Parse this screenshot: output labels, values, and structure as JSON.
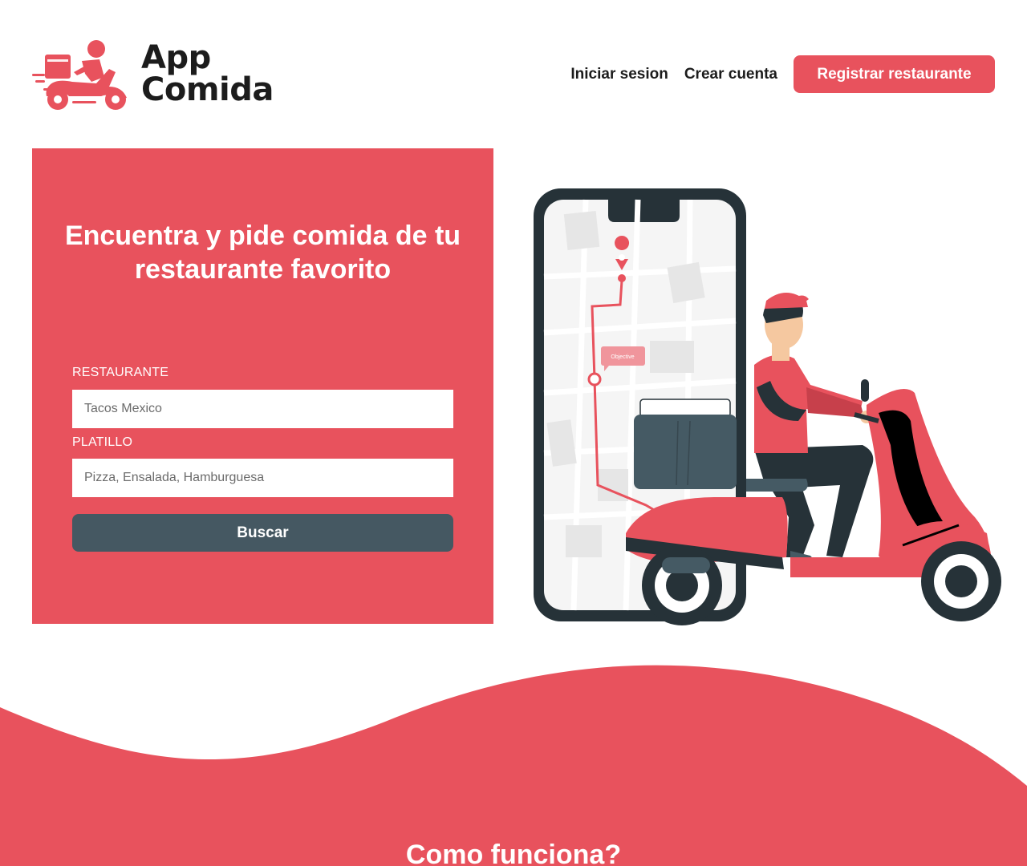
{
  "brand": {
    "name_line1": "App",
    "name_line2": "Comida",
    "icon": "delivery-scooter-logo-icon",
    "accent_color": "#e8525d",
    "dark_color": "#455862"
  },
  "nav": {
    "login_label": "Iniciar sesion",
    "signup_label": "Crear cuenta",
    "register_restaurant_label": "Registrar restaurante"
  },
  "hero": {
    "title": "Encuentra y pide comida de tu restaurante favorito",
    "restaurant_label": "RESTAURANTE",
    "restaurant_placeholder": "Tacos Mexico",
    "dish_label": "PLATILLO",
    "dish_placeholder": "Pizza, Ensalada, Hamburguesa",
    "search_label": "Buscar"
  },
  "illustration": {
    "icon": "delivery-rider-phone-map-illustration",
    "map_tag": "Objective"
  },
  "how_it_works": {
    "title": "Como funciona?"
  }
}
